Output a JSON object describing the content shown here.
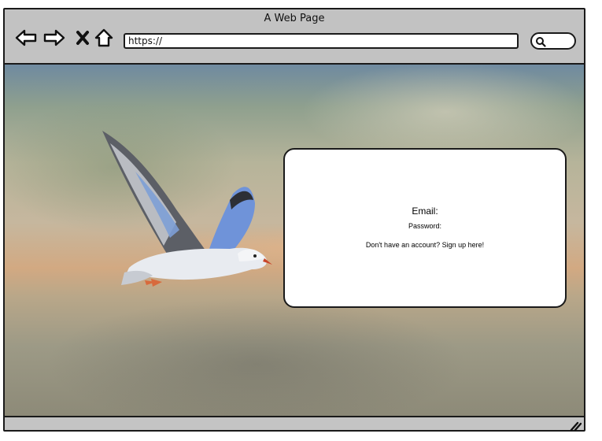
{
  "window": {
    "title": "A Web Page"
  },
  "toolbar": {
    "back_icon": "back-arrow-icon",
    "forward_icon": "forward-arrow-icon",
    "stop_icon": "close-icon",
    "home_icon": "home-icon",
    "address_value": "https://",
    "search_icon": "search-icon"
  },
  "login_card": {
    "email_label": "Email:",
    "password_label": "Password:",
    "signup_text": "Don't have an account? Sign up here!"
  },
  "statusbar": {
    "resize_icon": "resize-handle-icon"
  },
  "colors": {
    "chrome": "#c2c2c2",
    "outline": "#1a1a1a",
    "card": "#ffffff"
  }
}
